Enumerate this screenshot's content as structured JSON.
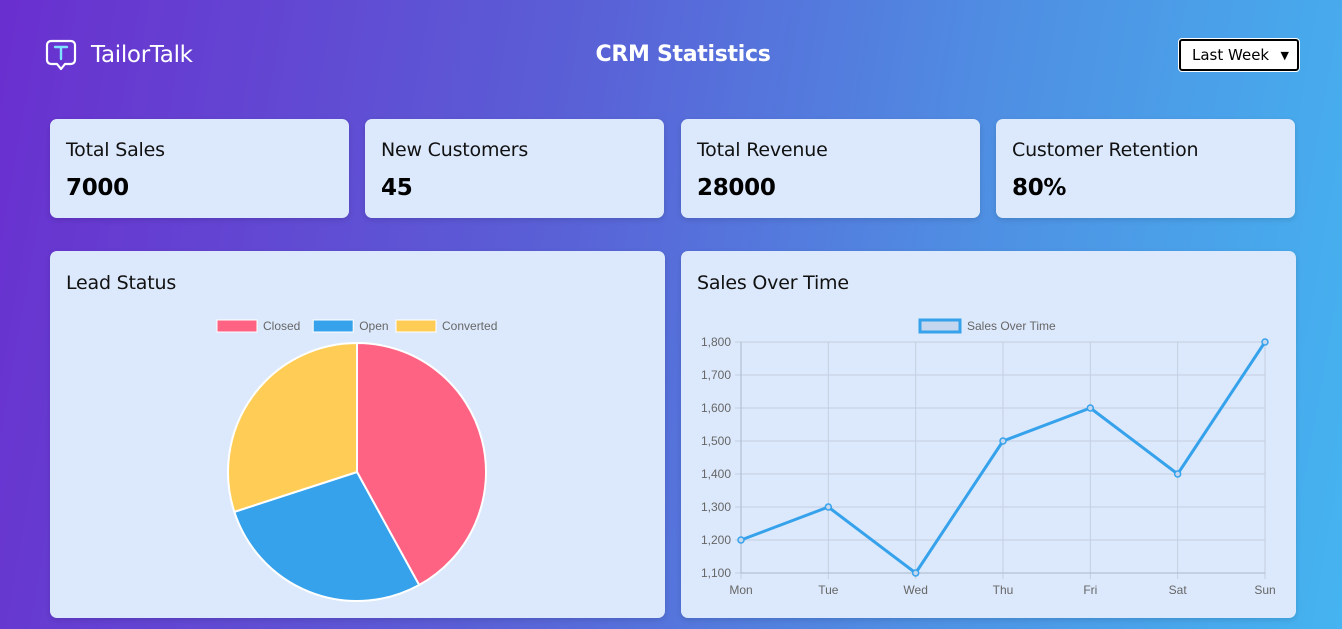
{
  "header": {
    "brand": "TailorTalk",
    "title": "CRM Statistics",
    "range_select": {
      "value": "Last Week"
    }
  },
  "stats": [
    {
      "title": "Total Sales",
      "value": "7000"
    },
    {
      "title": "New Customers",
      "value": "45"
    },
    {
      "title": "Total Revenue",
      "value": "28000"
    },
    {
      "title": "Customer Retention",
      "value": "80%"
    }
  ],
  "lead_status": {
    "title": "Lead Status"
  },
  "sales_over_time": {
    "title": "Sales Over Time"
  },
  "colors": {
    "closed": "#ff6384",
    "open": "#36a2eb",
    "converted": "#ffcd56",
    "line": "#36a2eb",
    "card_bg": "#dce9fc"
  },
  "chart_data": [
    {
      "type": "pie",
      "title": "Lead Status",
      "labels": [
        "Closed",
        "Open",
        "Converted"
      ],
      "values": [
        42,
        28,
        30
      ],
      "legend": "top"
    },
    {
      "type": "line",
      "title": "Sales Over Time",
      "categories": [
        "Mon",
        "Tue",
        "Wed",
        "Thu",
        "Fri",
        "Sat",
        "Sun"
      ],
      "series": [
        {
          "name": "Sales Over Time",
          "values": [
            1200,
            1300,
            1100,
            1500,
            1600,
            1400,
            1800
          ]
        }
      ],
      "ylim": [
        1100,
        1800
      ],
      "yticks": [
        "1,100",
        "1,200",
        "1,300",
        "1,400",
        "1,500",
        "1,600",
        "1,700",
        "1,800"
      ],
      "grid": true,
      "legend": "top"
    }
  ]
}
